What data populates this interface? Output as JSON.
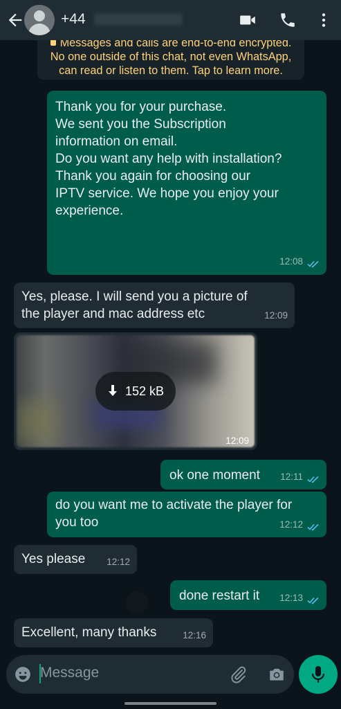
{
  "header": {
    "contact_name": "+44",
    "icons": [
      "back-arrow-icon",
      "avatar-icon",
      "video-call-icon",
      "phone-icon",
      "more-vert-icon"
    ]
  },
  "encryption_notice": {
    "lines": [
      "Messages and calls are end-to-end encrypted.",
      "No one outside of this chat, not even WhatsApp,",
      "can read or listen to them. Tap to learn more."
    ]
  },
  "messages": [
    {
      "direction": "outgoing",
      "lines": [
        "Thank you for your purchase.",
        "",
        "We sent you the Subscription",
        "information on email.",
        "",
        "Do you want any help with installation?",
        "",
        "Thank you again for choosing our",
        "IPTV service. We hope you enjoy your",
        "experience."
      ],
      "time": "12:08",
      "status": "read"
    },
    {
      "direction": "incoming",
      "lines": [
        "Yes, please. I will send you a picture of",
        "the player and mac address etc"
      ],
      "time": "12:09"
    },
    {
      "direction": "incoming",
      "type": "image",
      "download_size": "152 kB",
      "time": "12:09"
    },
    {
      "direction": "outgoing",
      "lines": [
        "ok one moment"
      ],
      "time": "12:11",
      "status": "read"
    },
    {
      "direction": "outgoing",
      "lines": [
        "do you want me to activate the player for",
        "you too"
      ],
      "time": "12:12",
      "status": "read"
    },
    {
      "direction": "incoming",
      "lines": [
        "Yes please"
      ],
      "time": "12:12"
    },
    {
      "direction": "outgoing",
      "lines": [
        "done restart it"
      ],
      "time": "12:13",
      "status": "read"
    },
    {
      "direction": "incoming",
      "lines": [
        "Excellent, many thanks"
      ],
      "time": "12:16"
    }
  ],
  "composer": {
    "placeholder": "Message",
    "icons": [
      "emoji-icon",
      "attach-icon",
      "camera-icon",
      "mic-icon"
    ]
  },
  "colors": {
    "background": "#0b141a",
    "header": "#1f2c34",
    "outgoing_bubble": "#005c4b",
    "incoming_bubble": "#202c33",
    "accent": "#00a884",
    "read_ticks": "#53bdeb",
    "notice_text": "#ffd279"
  }
}
